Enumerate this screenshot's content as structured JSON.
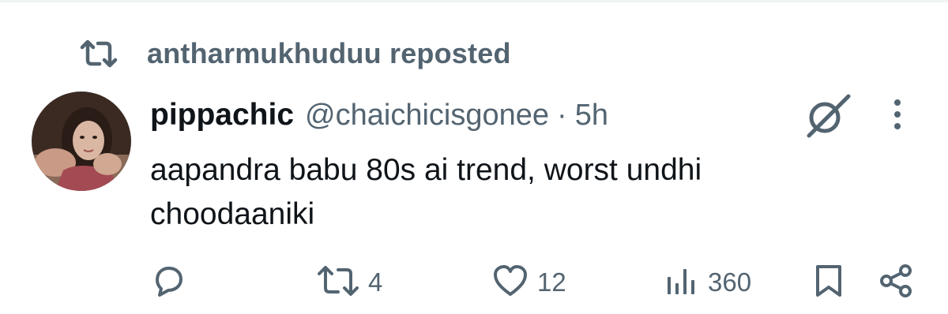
{
  "repost": {
    "label": "antharmukhuduu reposted",
    "icon": "repost-icon"
  },
  "post": {
    "display_name": "pippachic",
    "handle": "@chaichicisgonee",
    "separator": "·",
    "time": "5h",
    "text_line1": "aapandra babu 80s ai trend, worst undhi",
    "text_line2": "choodaaniki"
  },
  "actions": {
    "reply_count": "",
    "repost_count": "4",
    "like_count": "12",
    "view_count": "360"
  },
  "colors": {
    "text": "#0f1419",
    "secondary": "#536471"
  }
}
